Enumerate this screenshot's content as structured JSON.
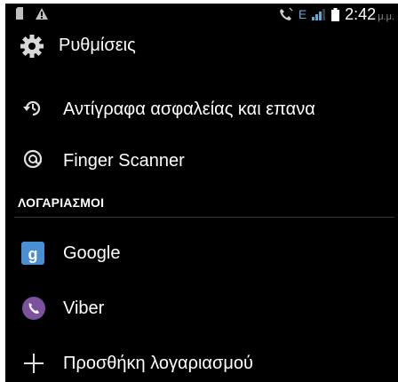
{
  "status_bar": {
    "time": "2:42",
    "ampm": "μ.μ.",
    "network_type": "E",
    "icons": [
      "sim-card-icon",
      "warning-icon",
      "phone-vibrate-icon",
      "network-type-icon",
      "signal-icon",
      "battery-icon"
    ]
  },
  "action_bar": {
    "title": "Ρυθμίσεις",
    "icon": "settings-gear-icon"
  },
  "items": [
    {
      "label": "Αντίγραφα ασφαλείας και επανα",
      "icon": "backup-restore-icon"
    },
    {
      "label": "Finger Scanner",
      "icon": "fingerprint-icon"
    }
  ],
  "accounts_header": "ΛΟΓΑΡΙΑΣΜΟΙ",
  "accounts": [
    {
      "label": "Google",
      "icon": "google-icon",
      "color": "#4a8fd4"
    },
    {
      "label": "Viber",
      "icon": "viber-icon",
      "color": "#7c529e"
    }
  ],
  "add_account": {
    "label": "Προσθήκη λογαριασμού",
    "icon": "plus-icon"
  },
  "colors": {
    "background": "#000000",
    "text": "#ffffff",
    "accent": "#33b5e5"
  }
}
